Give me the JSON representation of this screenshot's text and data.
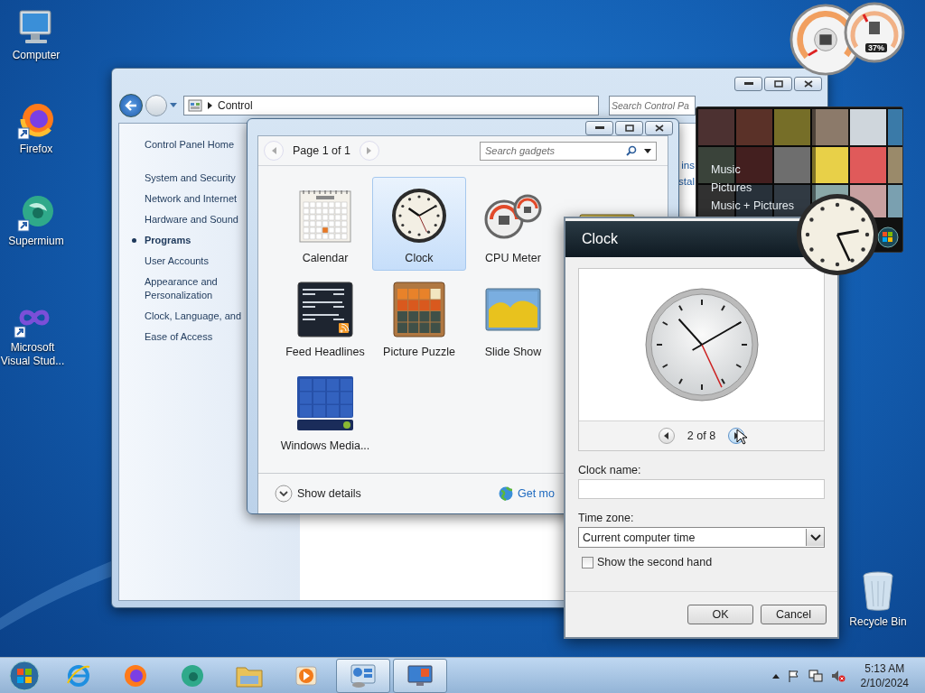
{
  "desktop_icons": [
    {
      "label": "Computer",
      "kind": "computer"
    },
    {
      "label": "Firefox",
      "kind": "firefox"
    },
    {
      "label": "Supermium",
      "kind": "supermium"
    },
    {
      "label": "Microsoft Visual Stud...",
      "kind": "vs"
    },
    {
      "label": "Recycle Bin",
      "kind": "recycle"
    }
  ],
  "control_panel": {
    "address": "Control",
    "search_placeholder": "Search Control Pa",
    "home": "Control Panel Home",
    "sidebar": [
      {
        "label": "System and Security",
        "selected": false
      },
      {
        "label": "Network and Internet",
        "selected": false
      },
      {
        "label": "Hardware and Sound",
        "selected": false
      },
      {
        "label": "Programs",
        "selected": true
      },
      {
        "label": "User Accounts",
        "selected": false
      },
      {
        "label": "Appearance and Personalization",
        "selected": false
      },
      {
        "label": "Clock, Language, and",
        "selected": false
      },
      {
        "label": "Ease of Access",
        "selected": false
      }
    ],
    "content_fragments": [
      "ins",
      "stal"
    ]
  },
  "gadgets_window": {
    "page": "Page 1 of 1",
    "search_placeholder": "Search gadgets",
    "gadgets": [
      {
        "label": "Calendar",
        "kind": "calendar",
        "selected": false
      },
      {
        "label": "Clock",
        "kind": "clock",
        "selected": true
      },
      {
        "label": "CPU Meter",
        "kind": "cpu",
        "selected": false
      },
      {
        "kind": "gold",
        "selected": false
      },
      {
        "label": "Feed Headlines",
        "kind": "feed",
        "selected": false
      },
      {
        "label": "Picture Puzzle",
        "kind": "puzzle",
        "selected": false
      },
      {
        "label": "Slide Show",
        "kind": "slides",
        "selected": false
      },
      {
        "label": "Windows Media...",
        "kind": "media",
        "selected": false
      }
    ],
    "show_details": "Show details",
    "get_more": "Get mo"
  },
  "media_gadget": {
    "items": [
      "Music",
      "Pictures",
      "Music + Pictures"
    ]
  },
  "cpu_gadget": {
    "reading": "37%"
  },
  "clock_dialog": {
    "title": "Clock",
    "pager": "2 of 8",
    "name_label": "Clock name:",
    "timezone_label": "Time zone:",
    "timezone": "Current computer time",
    "second_hand": {
      "label": "Show the second hand",
      "checked": false
    },
    "buttons": [
      "OK",
      "Cancel"
    ]
  },
  "taskbar": {
    "apps": [
      {
        "kind": "ie",
        "active": false
      },
      {
        "kind": "firefox",
        "active": false
      },
      {
        "kind": "supermium",
        "active": false
      },
      {
        "kind": "explorer",
        "active": false
      },
      {
        "kind": "player",
        "active": false
      },
      {
        "kind": "gadgets",
        "active": true
      },
      {
        "kind": "monitor",
        "active": true
      }
    ],
    "time": "5:13 AM",
    "date": "2/10/2024"
  }
}
